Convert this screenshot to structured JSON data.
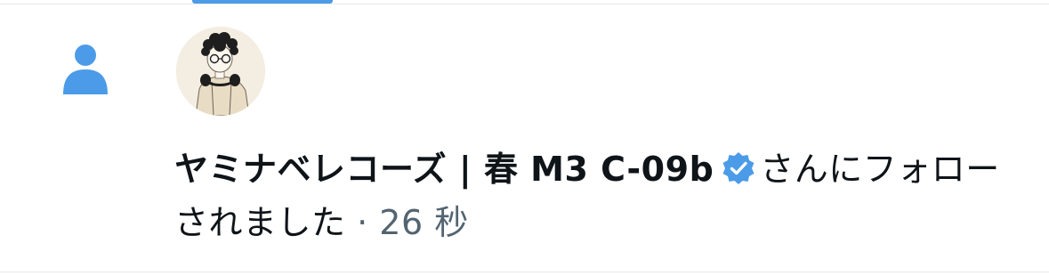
{
  "notification": {
    "user_name": "ヤミナベレコーズ | 春 M3 C-09b",
    "action_text": "さんにフォローされました",
    "separator": " · ",
    "timestamp": "26 秒",
    "icon": "person-icon",
    "badge_icon": "verified-badge-icon"
  },
  "colors": {
    "accent": "#4c9be8",
    "text": "#0f1419",
    "secondary_text": "#536471",
    "divider": "#e6e9ec"
  }
}
